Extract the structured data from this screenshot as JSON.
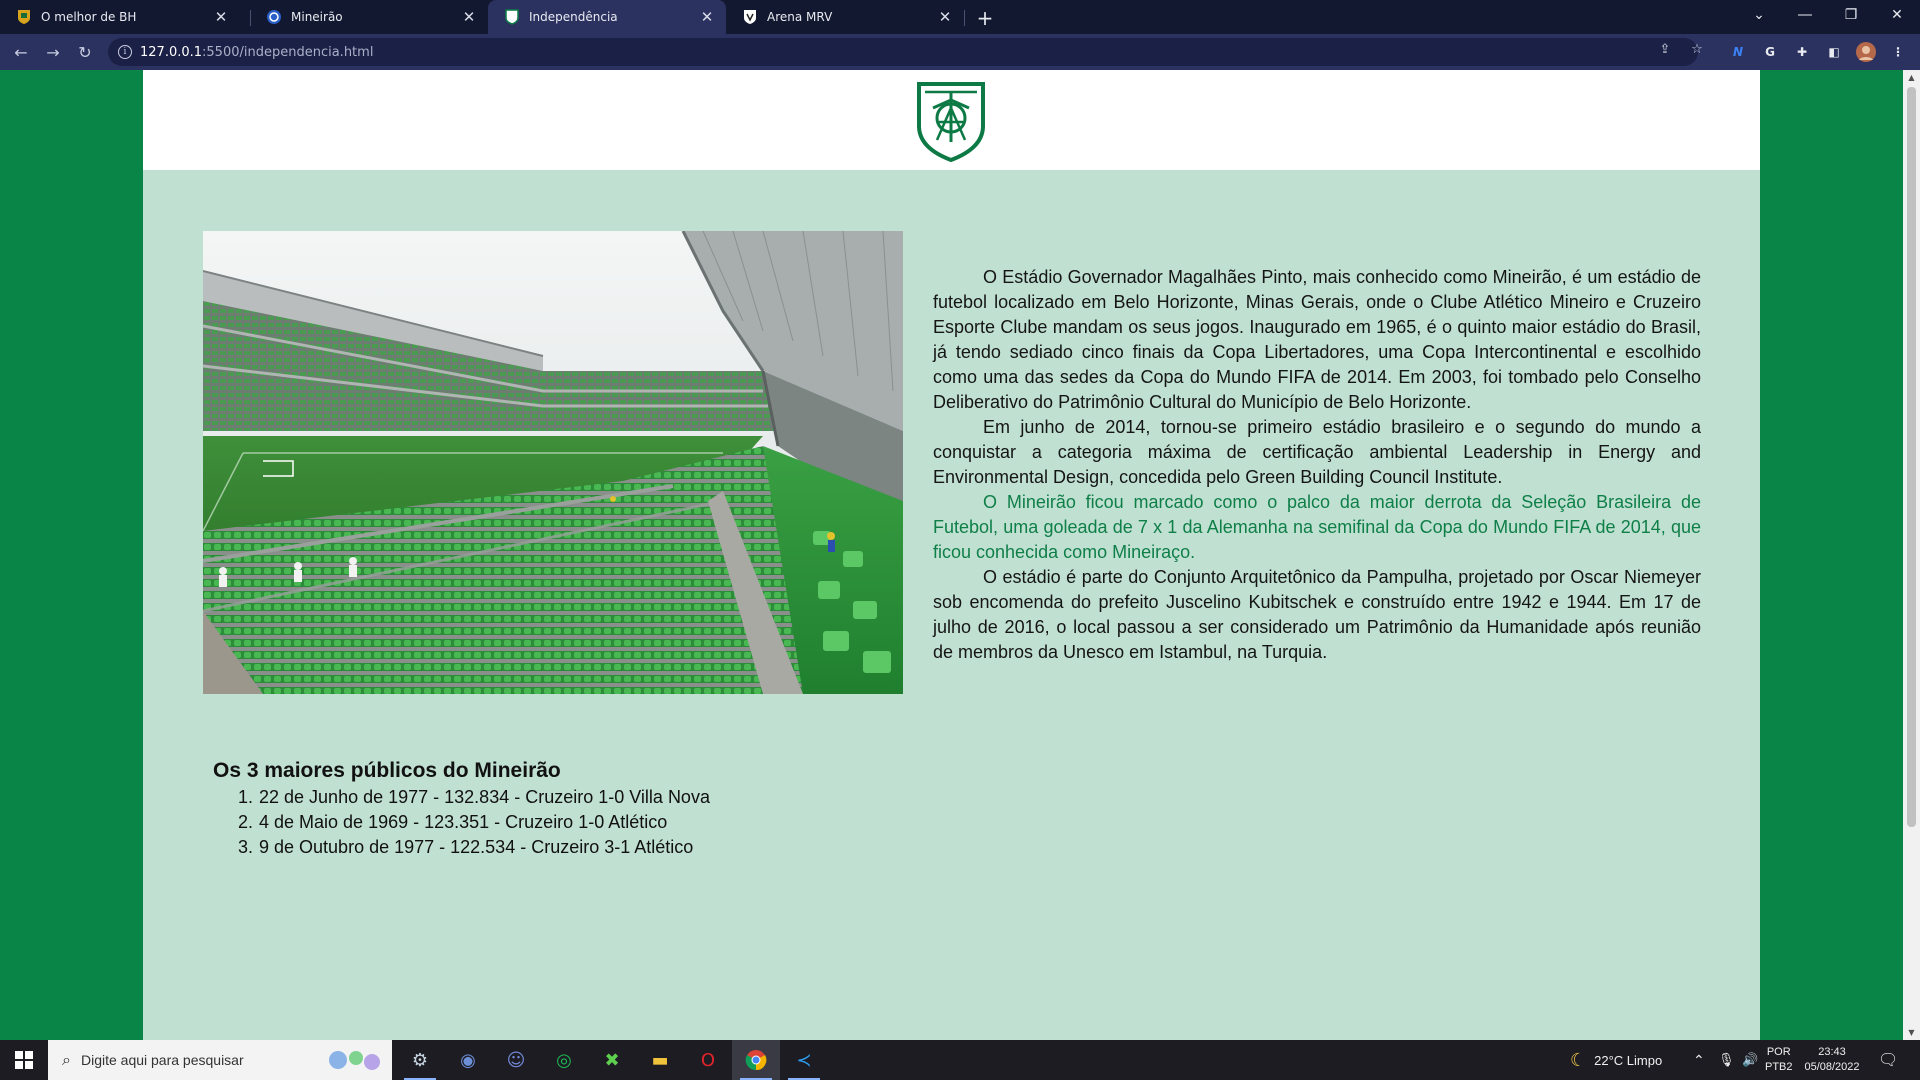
{
  "browser": {
    "tabs": [
      {
        "title": "O melhor de BH",
        "icon": "club-shield-icon",
        "active": false
      },
      {
        "title": "Mineirão",
        "icon": "globe-icon",
        "active": false
      },
      {
        "title": "Independência",
        "icon": "shield-icon",
        "active": true
      },
      {
        "title": "Arena MRV",
        "icon": "shield-icon",
        "active": false
      }
    ],
    "url_host": "127.0.0.1",
    "url_path": ":5500/independencia.html"
  },
  "page": {
    "article": {
      "paragraphs": [
        "O Estádio Governador Magalhães Pinto, mais conhecido como Mineirão, é um estádio de futebol localizado em Belo Horizonte, Minas Gerais, onde o Clube Atlético Mineiro e Cruzeiro Esporte Clube mandam os seus jogos. Inaugurado em 1965, é o quinto maior estádio do Brasil, já tendo sediado cinco finais da Copa Libertadores, uma Copa Intercontinental e escolhido como uma das sedes da Copa do Mundo FIFA de 2014. Em 2003, foi tombado pelo Conselho Deliberativo do Patrimônio Cultural do Município de Belo Horizonte.",
        "Em junho de 2014, tornou-se primeiro estádio brasileiro e o segundo do mundo a conquistar a categoria máxima de certificação ambiental Leadership in Energy and Environmental Design, concedida pelo Green Building Council Institute.",
        "O Mineirão ficou marcado como o palco da maior derrota da Seleção Brasileira de Futebol, uma goleada de 7 x 1 da Alemanha na semifinal da Copa do Mundo FIFA de 2014, que ficou conhecida como Mineiraço.",
        "O estádio é parte do Conjunto Arquitetônico da Pampulha, projetado por Oscar Niemeyer sob encomenda do prefeito Juscelino Kubitschek e construído entre 1942 e 1944. Em 17 de julho de 2016, o local passou a ser considerado um Patrimônio da Humanidade após reunião de membros da Unesco em Istambul, na Turquia."
      ]
    },
    "records": {
      "title": "Os 3 maiores públicos do Mineirão",
      "items": [
        {
          "num": "1.",
          "text": "22 de Junho de 1977 - 132.834 - Cruzeiro 1-0 Villa Nova"
        },
        {
          "num": "2.",
          "text": "4 de Maio de 1969 - 123.351 - Cruzeiro 1-0 Atlético"
        },
        {
          "num": "3.",
          "text": "9 de Outubro de 1977 - 122.534 - Cruzeiro 3-1 Atlético"
        }
      ]
    }
  },
  "taskbar": {
    "search_placeholder": "Digite aqui para pesquisar",
    "weather": "22°C  Limpo",
    "lang_1": "POR",
    "lang_2": "PTB2",
    "time": "23:43",
    "date": "05/08/2022"
  },
  "colors": {
    "page_background": "#0a8548",
    "content_background": "#c0e0d2",
    "highlight_text": "#0f7f48",
    "crest_green": "#0d7a45"
  }
}
